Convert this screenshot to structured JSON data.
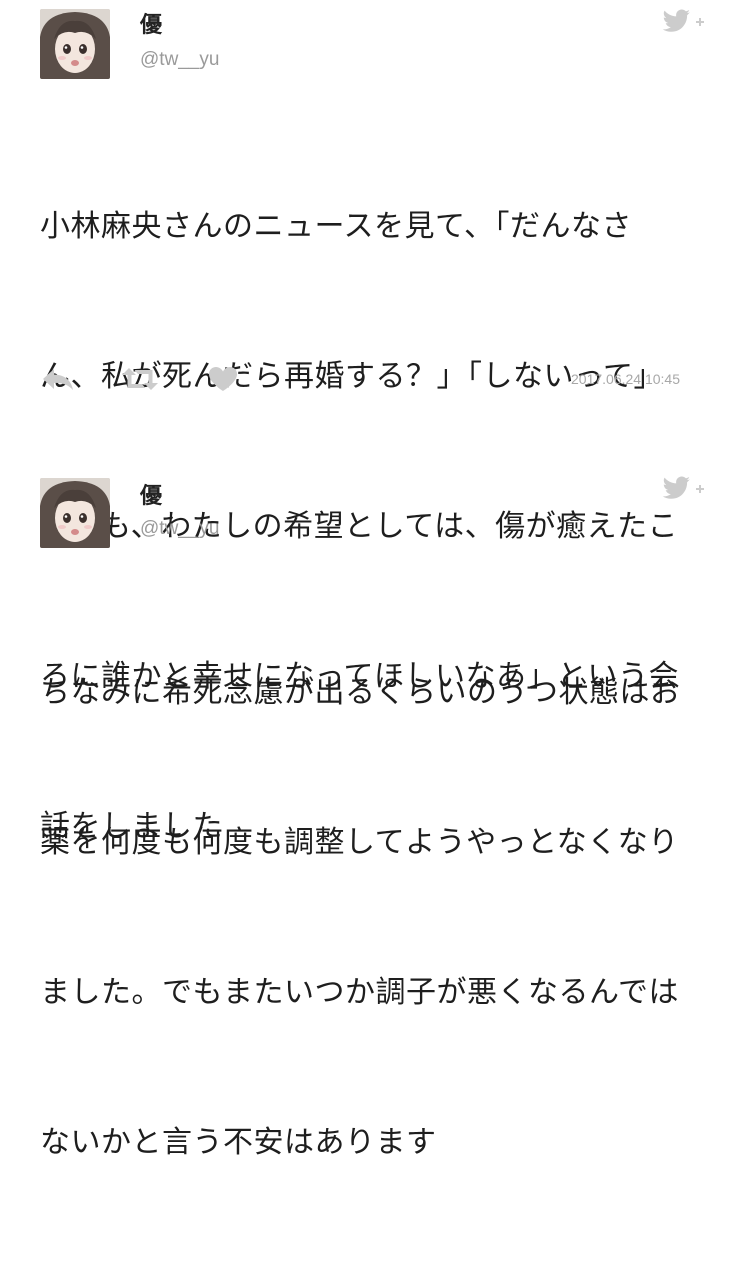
{
  "colors": {
    "icon_gray": "#cccccc",
    "handle_gray": "#9a9a9a",
    "text": "#1e1e1e",
    "timestamp_gray": "#a8a8a8"
  },
  "tweets": [
    {
      "display_name": "優",
      "handle": "@tw__yu",
      "text": "小林麻央さんのニュースを見て、「だんなさん、私が死んだら再婚する？」「しないって」「でも、わたしの希望としては、傷が癒えたころに誰かと幸せになってほしいなあ」という会話をしました",
      "lines": [
        "小林麻央さんのニュースを見て、「だんなさ",
        "ん、私が死んだら再婚する？」「しないって」",
        "「でも、わたしの希望としては、傷が癒えたこ",
        "ろに誰かと幸せになってほしいなあ」という会",
        "話をしました"
      ],
      "timestamp": "2017.06.24 10:45",
      "icons": [
        "reply-icon",
        "retweet-icon",
        "like-icon",
        "twitter-bird-icon"
      ]
    },
    {
      "display_name": "優",
      "handle": "@tw__yu",
      "text": "ちなみに希死念慮が出るくらいのうつ状態はお薬を何度も何度も調整してようやっとなくなりました。でもまたいつか調子が悪くなるんではないかと言う不安はあります",
      "lines": [
        "ちなみに希死念慮が出るくらいのうつ状態はお",
        "薬を何度も何度も調整してようやっとなくなり",
        "ました。でもまたいつか調子が悪くなるんでは",
        "ないかと言う不安はあります"
      ],
      "icons": [
        "twitter-bird-icon"
      ]
    }
  ]
}
